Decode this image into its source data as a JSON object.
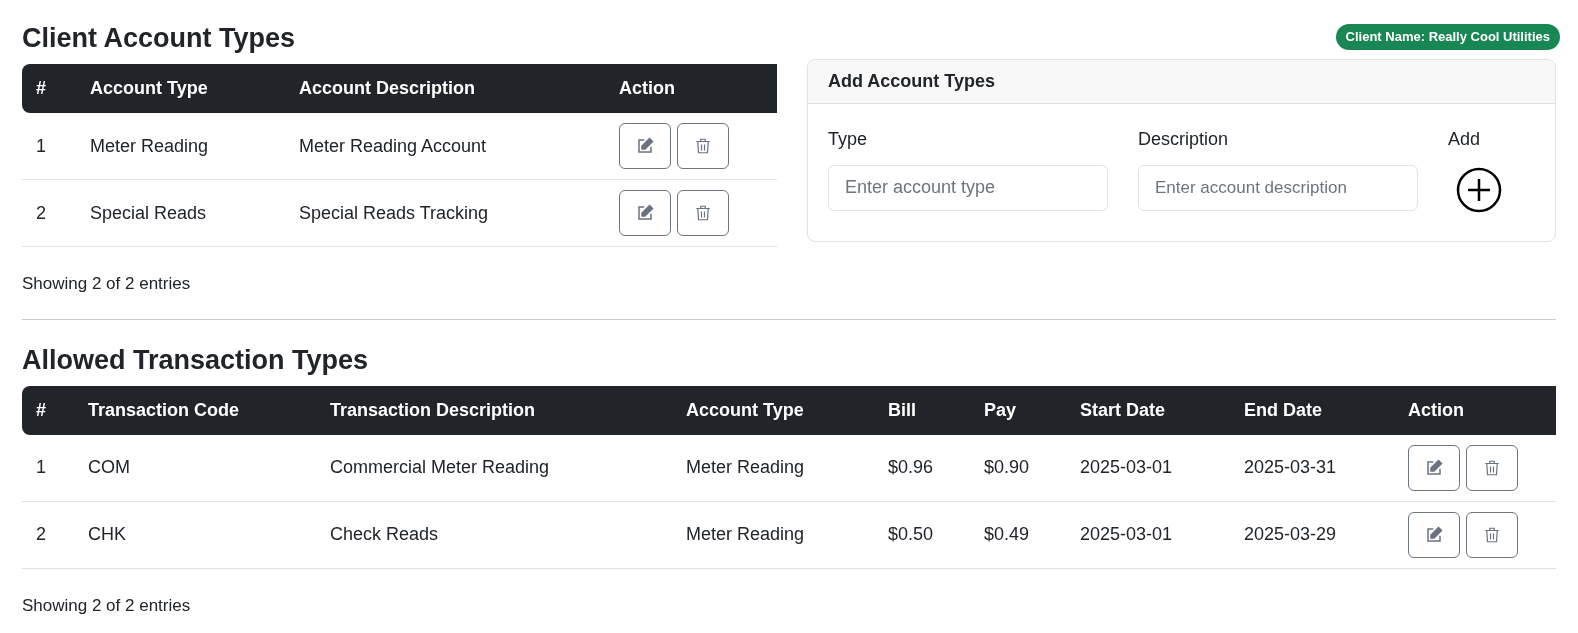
{
  "account_section": {
    "title": "Client Account Types",
    "client_badge": "Client Name: Really Cool Utilities",
    "table": {
      "columns": [
        "#",
        "Account Type",
        "Account Description",
        "Action"
      ],
      "rows": [
        {
          "cells": [
            "1",
            "Meter Reading",
            "Meter Reading Account"
          ]
        },
        {
          "cells": [
            "2",
            "Special Reads",
            "Special Reads Tracking"
          ]
        }
      ]
    },
    "footer": "Showing 2 of 2 entries"
  },
  "add_card": {
    "title": "Add Account Types",
    "type_label": "Type",
    "type_placeholder": "Enter account type",
    "description_label": "Description",
    "description_placeholder": "Enter account description",
    "add_label": "Add"
  },
  "transaction_section": {
    "title": "Allowed Transaction Types",
    "table": {
      "columns": [
        "#",
        "Transaction Code",
        "Transaction Description",
        "Account Type",
        "Bill",
        "Pay",
        "Start Date",
        "End Date",
        "Action"
      ],
      "rows": [
        {
          "cells": [
            "1",
            "COM",
            "Commercial Meter Reading",
            "Meter Reading",
            "$0.96",
            "$0.90",
            "2025-03-01",
            "2025-03-31"
          ]
        },
        {
          "cells": [
            "2",
            "CHK",
            "Check Reads",
            "Meter Reading",
            "$0.50",
            "$0.49",
            "2025-03-01",
            "2025-03-29"
          ]
        }
      ]
    },
    "footer": "Showing 2 of 2 entries"
  }
}
